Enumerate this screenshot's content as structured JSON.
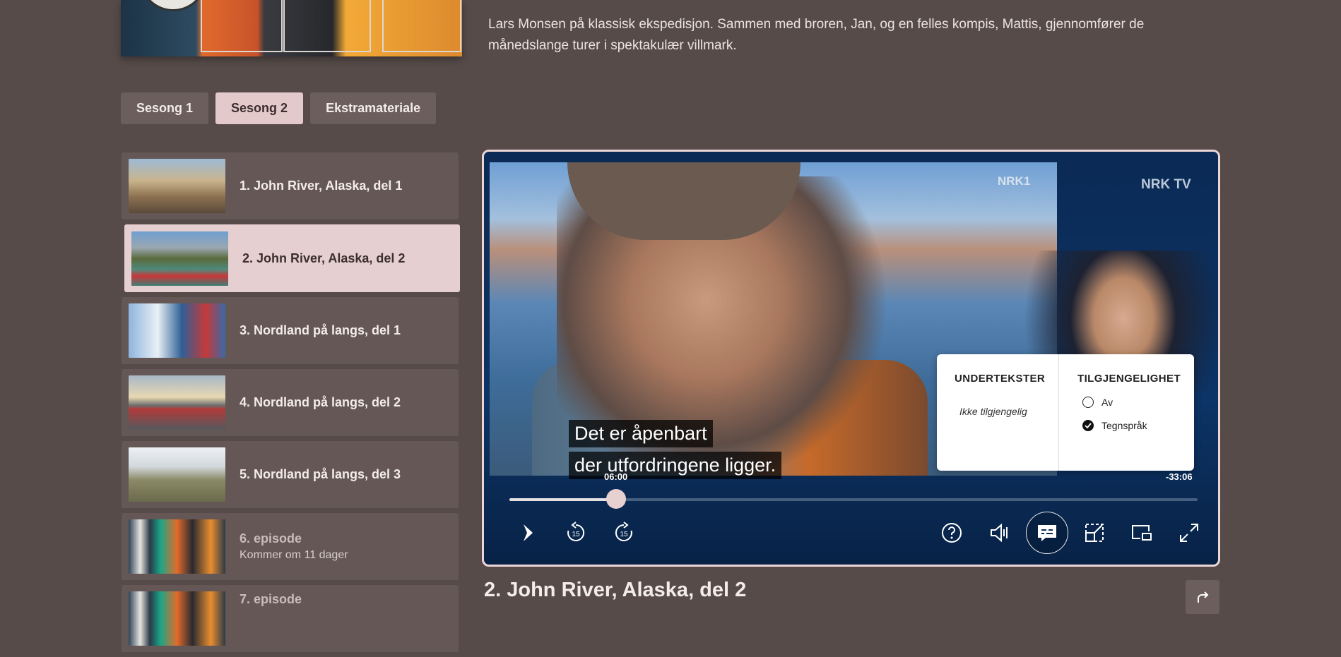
{
  "series": {
    "description": "Lars Monsen på klassisk ekspedisjon. Sammen med broren, Jan, og en felles kompis, Mattis, gjennomfører de månedslange turer i spektakulær villmark."
  },
  "season_tabs": [
    {
      "label": "Sesong 1",
      "active": false
    },
    {
      "label": "Sesong 2",
      "active": true
    },
    {
      "label": "Ekstramateriale",
      "active": false
    }
  ],
  "episodes": [
    {
      "title": "1. John River, Alaska, del 1",
      "subtitle": "",
      "active": false
    },
    {
      "title": "2. John River, Alaska, del 2",
      "subtitle": "",
      "active": true
    },
    {
      "title": "3. Nordland på langs, del 1",
      "subtitle": "",
      "active": false
    },
    {
      "title": "4. Nordland på langs, del 2",
      "subtitle": "",
      "active": false
    },
    {
      "title": "5. Nordland på langs, del 3",
      "subtitle": "",
      "active": false
    },
    {
      "title": "6. episode",
      "subtitle": "Kommer om 11 dager",
      "active": false
    },
    {
      "title": "7. episode",
      "subtitle": "",
      "active": false
    }
  ],
  "player": {
    "channel_logo": "NRK1",
    "brand_logo": "NRK TV",
    "subtitle_lines": [
      "Det er åpenbart",
      "der utfordringene ligger."
    ],
    "current_time": "06:00",
    "remaining_time": "-33:06",
    "progress_fraction": 0.155,
    "settings": {
      "subtitles_heading": "UNDERTEKSTER",
      "subtitles_note": "Ikke tilgjengelig",
      "accessibility_heading": "TILGJENGELIGHET",
      "options": [
        {
          "label": "Av",
          "checked": false
        },
        {
          "label": "Tegnspråk",
          "checked": true
        }
      ]
    },
    "controls": [
      {
        "name": "play-button",
        "icon": "play-icon"
      },
      {
        "name": "rewind-15-button",
        "icon": "rewind-15-icon"
      },
      {
        "name": "forward-15-button",
        "icon": "forward-15-icon"
      },
      {
        "name": "help-button",
        "icon": "help-icon"
      },
      {
        "name": "volume-button",
        "icon": "volume-icon"
      },
      {
        "name": "subtitles-button",
        "icon": "subtitles-icon"
      },
      {
        "name": "shrink-button",
        "icon": "shrink-icon"
      },
      {
        "name": "picture-in-picture-button",
        "icon": "picture-in-picture-icon"
      },
      {
        "name": "fullscreen-button",
        "icon": "fullscreen-icon"
      }
    ],
    "rewind_label": "15",
    "forward_label": "15"
  },
  "current_episode": {
    "title": "2. John River, Alaska, del 2"
  },
  "colors": {
    "background": "#564b49",
    "accent_pink": "#e3c9ca",
    "player_border": "#ecd6d6"
  }
}
